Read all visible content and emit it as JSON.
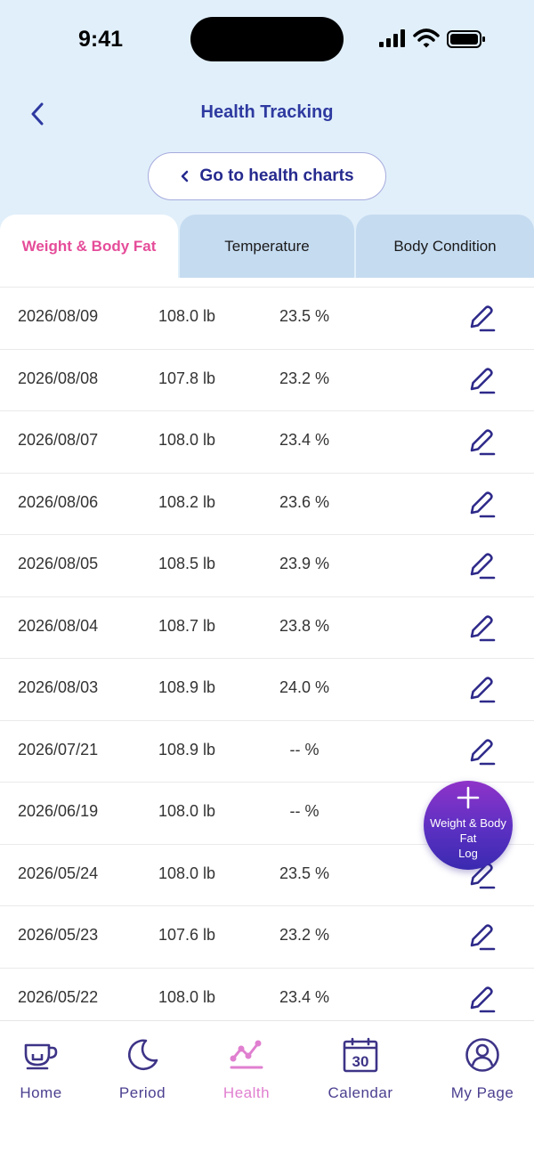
{
  "status_bar": {
    "time": "9:41"
  },
  "header": {
    "title": "Health Tracking"
  },
  "charts_button": {
    "label": "Go to health charts"
  },
  "tabs": [
    {
      "label": "Weight & Body Fat",
      "active": true
    },
    {
      "label": "Temperature",
      "active": false
    },
    {
      "label": "Body Condition",
      "active": false
    }
  ],
  "records": [
    {
      "date": "2026/08/09",
      "weight": "108.0 lb",
      "fat": "23.5 %"
    },
    {
      "date": "2026/08/08",
      "weight": "107.8 lb",
      "fat": "23.2 %"
    },
    {
      "date": "2026/08/07",
      "weight": "108.0 lb",
      "fat": "23.4 %"
    },
    {
      "date": "2026/08/06",
      "weight": "108.2 lb",
      "fat": "23.6 %"
    },
    {
      "date": "2026/08/05",
      "weight": "108.5 lb",
      "fat": "23.9 %"
    },
    {
      "date": "2026/08/04",
      "weight": "108.7 lb",
      "fat": "23.8 %"
    },
    {
      "date": "2026/08/03",
      "weight": "108.9 lb",
      "fat": "24.0 %"
    },
    {
      "date": "2026/07/21",
      "weight": "108.9 lb",
      "fat": "-- %"
    },
    {
      "date": "2026/06/19",
      "weight": "108.0 lb",
      "fat": "-- %"
    },
    {
      "date": "2026/05/24",
      "weight": "108.0 lb",
      "fat": "23.5 %"
    },
    {
      "date": "2026/05/23",
      "weight": "107.6 lb",
      "fat": "23.2 %"
    },
    {
      "date": "2026/05/22",
      "weight": "108.0 lb",
      "fat": "23.4 %"
    }
  ],
  "fab": {
    "label": "Weight & Body\nFat\nLog"
  },
  "bottom_nav": [
    {
      "label": "Home",
      "icon": "home-cup-icon",
      "active": false
    },
    {
      "label": "Period",
      "icon": "moon-icon",
      "active": false
    },
    {
      "label": "Health",
      "icon": "health-graph-icon",
      "active": true
    },
    {
      "label": "Calendar",
      "icon": "calendar-icon",
      "active": false,
      "calendar_day": "30"
    },
    {
      "label": "My Page",
      "icon": "user-icon",
      "active": false
    }
  ],
  "colors": {
    "top_background": "#e1effa",
    "accent_navy": "#2e3aa0",
    "active_tab": "#e54c99",
    "inactive_tab": "#c5dbf0",
    "nav_active": "#e07fd0"
  }
}
